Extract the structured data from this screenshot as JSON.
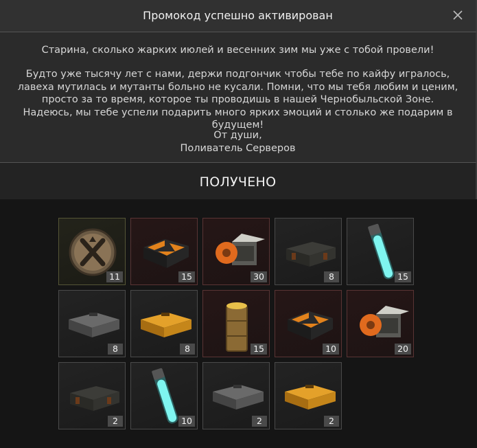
{
  "dialog": {
    "title": "Промокод успешно активирован",
    "close_icon": "close-icon",
    "message": {
      "line1": "Старина, сколько жарких июлей и весенних зим мы уже с тобой провели!",
      "paragraph": "Будто уже тысячу лет с нами, держи подгончик чтобы тебе по кайфу игралось, лавеха мутилась и мутанты больно не кусали. Помни, что мы тебя любим и ценим, просто за то время, которое ты проводишь в нашей Чернобыльской Зоне. Надеюсь, мы тебе успели подарить много ярких эмоций и столько же подарим в будущем!",
      "signature_1": "От души,",
      "signature_2": "Поливатель Серверов"
    },
    "received_label": "ПОЛУЧЕНО"
  },
  "rewards": [
    {
      "icon": "emblem-token-icon",
      "rarity": "gold",
      "count": "11"
    },
    {
      "icon": "hazard-crate-icon",
      "rarity": "rare",
      "count": "15"
    },
    {
      "icon": "open-box-icon",
      "rarity": "rare",
      "count": "30"
    },
    {
      "icon": "ammo-crate-icon",
      "rarity": "common",
      "count": "8"
    },
    {
      "icon": "glow-vial-icon",
      "rarity": "common",
      "count": "15"
    },
    {
      "icon": "gray-case-icon",
      "rarity": "common",
      "count": "8"
    },
    {
      "icon": "orange-case-icon",
      "rarity": "common",
      "count": "8"
    },
    {
      "icon": "canister-icon",
      "rarity": "rare",
      "count": "15"
    },
    {
      "icon": "hazard-crate-icon",
      "rarity": "rare",
      "count": "10"
    },
    {
      "icon": "open-box-icon",
      "rarity": "rare",
      "count": "20"
    },
    {
      "icon": "ammo-crate-icon",
      "rarity": "common",
      "count": "2"
    },
    {
      "icon": "glow-vial-icon",
      "rarity": "common",
      "count": "10"
    },
    {
      "icon": "gray-case-icon",
      "rarity": "common",
      "count": "2"
    },
    {
      "icon": "orange-case-icon",
      "rarity": "common",
      "count": "2"
    }
  ]
}
